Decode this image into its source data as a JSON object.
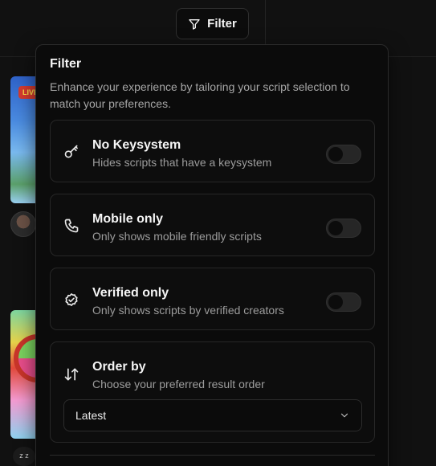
{
  "trigger": {
    "label": "Filter",
    "icon": "filter-icon"
  },
  "background": {
    "thumb_badge": "LIVE",
    "avatar_text": "z z"
  },
  "popover": {
    "title": "Filter",
    "description": "Enhance your experience by tailoring your script selection to match your preferences.",
    "options": [
      {
        "icon": "key-icon",
        "title": "No Keysystem",
        "subtitle": "Hides scripts that have a keysystem",
        "enabled": false
      },
      {
        "icon": "phone-icon",
        "title": "Mobile only",
        "subtitle": "Only shows mobile friendly scripts",
        "enabled": false
      },
      {
        "icon": "verified-badge-icon",
        "title": "Verified only",
        "subtitle": "Only shows scripts by verified creators",
        "enabled": false
      }
    ],
    "order": {
      "icon": "sort-arrows-icon",
      "title": "Order by",
      "subtitle": "Choose your preferred result order",
      "selected": "Latest"
    }
  }
}
